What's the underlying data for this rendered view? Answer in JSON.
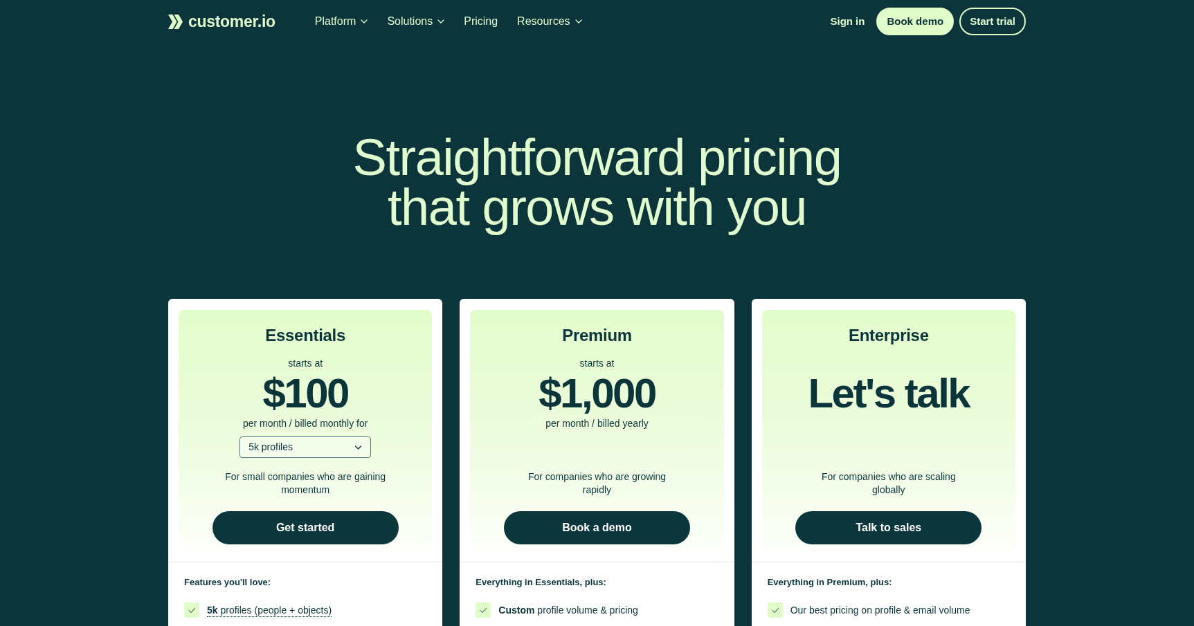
{
  "nav": {
    "logo": "customer.io",
    "links": [
      {
        "label": "Platform",
        "has_menu": true
      },
      {
        "label": "Solutions",
        "has_menu": true
      },
      {
        "label": "Pricing",
        "has_menu": false
      },
      {
        "label": "Resources",
        "has_menu": true
      }
    ],
    "actions": [
      {
        "label": "Sign in",
        "kind": "link"
      },
      {
        "label": "Book demo",
        "kind": "filled"
      },
      {
        "label": "Start trial",
        "kind": "outline"
      }
    ]
  },
  "hero": {
    "title": "Straightforward pricing that grows with you"
  },
  "plans": [
    {
      "name": "Essentials",
      "starts_at": "starts at",
      "price": "$100",
      "billing": "per month / billed monthly for",
      "profile_select": {
        "value": "5k profiles"
      },
      "description": "For small companies who are gaining momentum",
      "button": "Get started",
      "features_heading": "Features you'll love:",
      "features": [
        {
          "text": "**5k** profiles (people + objects)",
          "has_tooltip": true
        }
      ]
    },
    {
      "name": "Premium",
      "starts_at": "starts at",
      "price": "$1,000",
      "billing": "per month / billed yearly",
      "description": "For companies who are growing rapidly",
      "button": "Book a demo",
      "features_heading": "Everything in Essentials, plus:",
      "features": [
        {
          "text": "**Custom** profile volume & pricing",
          "has_tooltip": false
        }
      ]
    },
    {
      "name": "Enterprise",
      "price": "Let's talk",
      "description": "For companies who are scaling globally",
      "button": "Talk to sales",
      "features_heading": "Everything in Premium, plus:",
      "features": [
        {
          "text": "Our best pricing on profile & email volume",
          "has_tooltip": false
        }
      ]
    }
  ]
}
